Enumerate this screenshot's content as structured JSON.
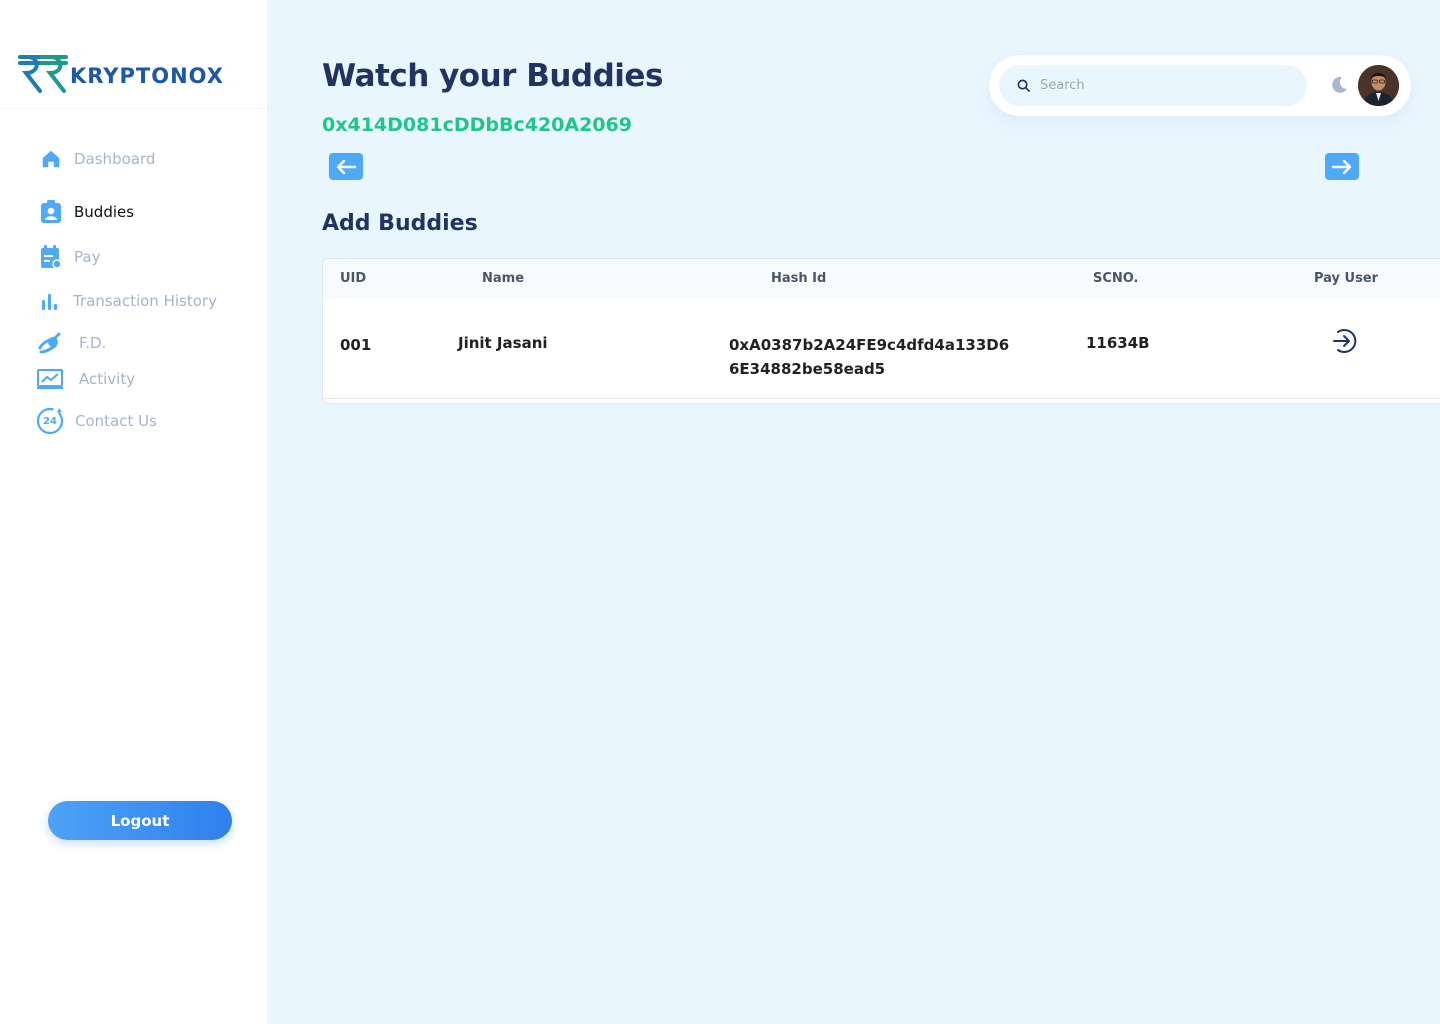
{
  "brand": {
    "name": "KRYPTONOX"
  },
  "sidebar": {
    "items": [
      {
        "label": "Dashboard",
        "icon": "home-icon"
      },
      {
        "label": "Buddies",
        "icon": "contact-badge-icon",
        "active": true
      },
      {
        "label": "Pay",
        "icon": "calendar-list-icon"
      },
      {
        "label": "Transaction History",
        "icon": "bar-chart-icon"
      },
      {
        "label": "F.D.",
        "icon": "hand-coin-icon"
      },
      {
        "label": "Activity",
        "icon": "line-chart-icon"
      },
      {
        "label": "Contact Us",
        "icon": "support-24-icon"
      }
    ],
    "logout_label": "Logout",
    "support_badge": "24"
  },
  "header": {
    "title": "Watch your Buddies",
    "wallet_address": "0x414D081cDDbBc420A2069",
    "search_placeholder": "Search"
  },
  "section": {
    "title": "Add Buddies"
  },
  "table": {
    "columns": [
      "UID",
      "Name",
      "Hash Id",
      "SCNO.",
      "Pay User"
    ],
    "rows": [
      {
        "uid": "001",
        "name": "Jinit Jasani",
        "hash_line1": "0xA0387b2A24FE9c4dfd4a133D6",
        "hash_line2": "6E34882be58ead5",
        "scno": "11634B"
      }
    ]
  },
  "colors": {
    "accent": "#4ea9f8",
    "title": "#223362",
    "wallet": "#20c58a",
    "inactive_nav": "#a6b4c8",
    "background": "#eaf6fe"
  }
}
